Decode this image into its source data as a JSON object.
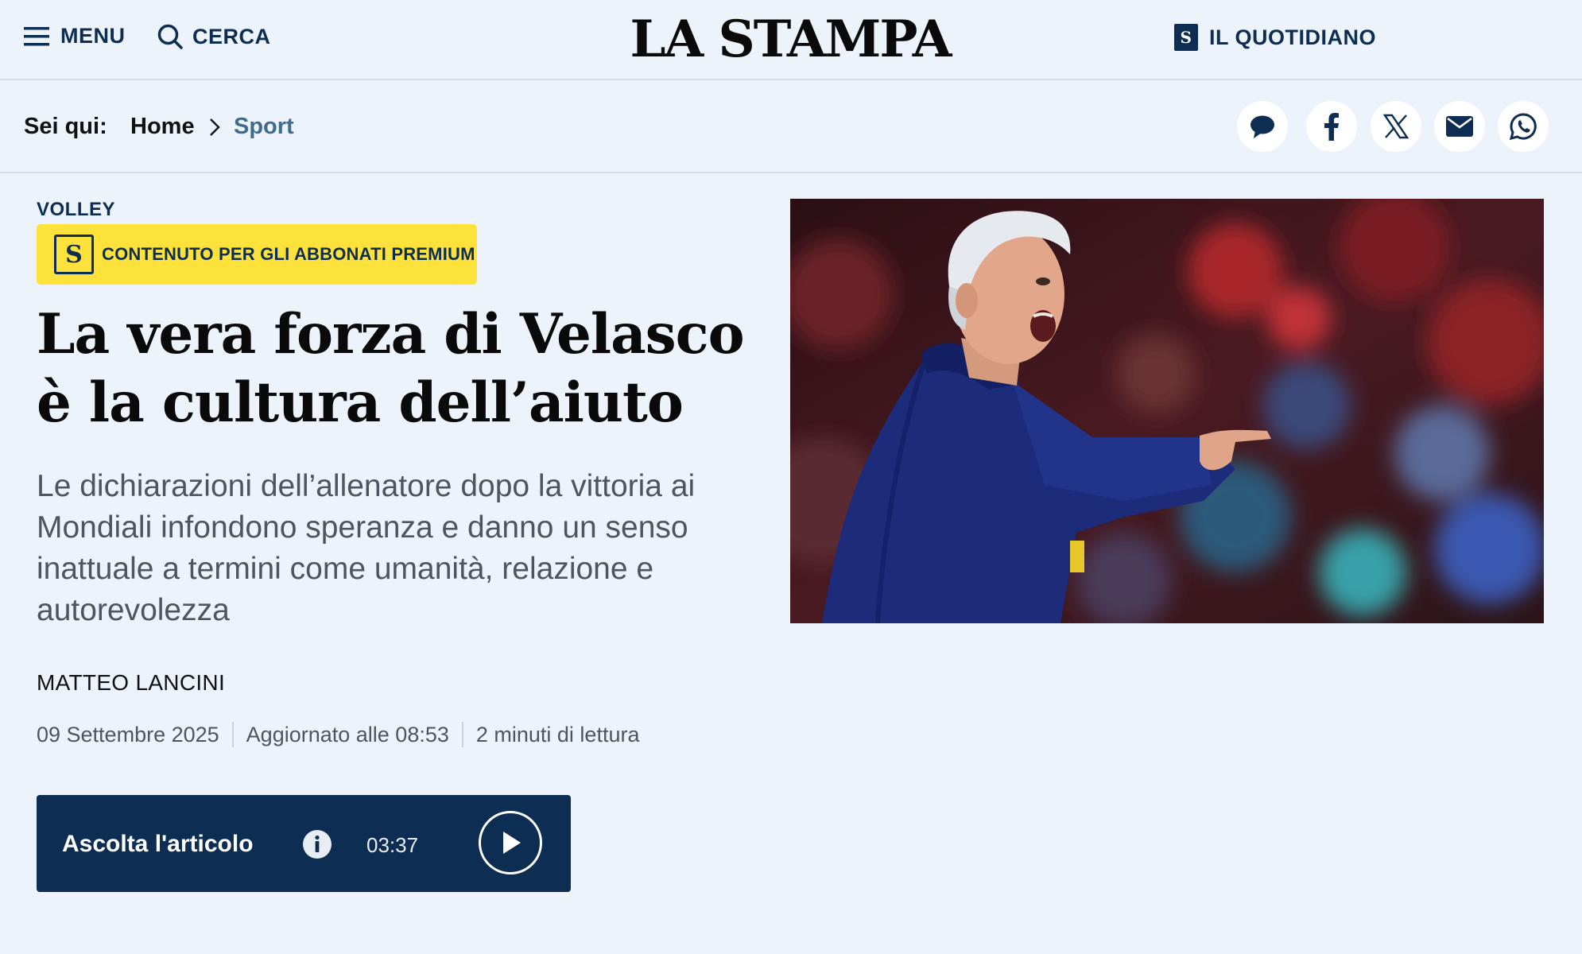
{
  "header": {
    "menu_label": "MENU",
    "search_label": "CERCA",
    "logo_text": "LA STAMPA",
    "quotidiano_label": "IL QUOTIDIANO",
    "quotidiano_badge": "S"
  },
  "breadcrumb": {
    "lead": "Sei qui:",
    "items": [
      "Home",
      "Sport"
    ]
  },
  "share": {
    "icons": [
      "comment-icon",
      "facebook-icon",
      "x-icon",
      "email-icon",
      "whatsapp-icon"
    ]
  },
  "article": {
    "kicker": "VOLLEY",
    "premium_badge": "S",
    "premium_label": "CONTENUTO PER GLI ABBONATI PREMIUM",
    "headline": "La vera forza di Velasco è la cultura dell’aiuto",
    "summary": "Le dichiarazioni dell’allenatore dopo la vittoria ai Mondiali infondono speranza e danno un senso inattuale a termini come umanità, relazione e autorevolezza",
    "author": "MATTEO LANCINI",
    "date": "09 Settembre 2025",
    "updated": "Aggiornato alle 08:53",
    "reading_time": "2 minuti di lettura"
  },
  "player": {
    "label": "Ascolta l'articolo",
    "duration": "03:37"
  },
  "colors": {
    "navy": "#0d2d52",
    "premium_yellow": "#fde23c",
    "background": "#edf3fa",
    "sport_link": "#3d6c8e"
  }
}
